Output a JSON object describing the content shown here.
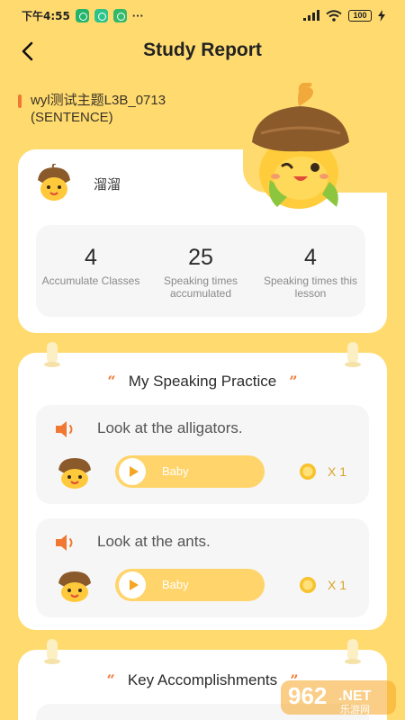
{
  "status": {
    "time": "下午4:55",
    "battery": "100",
    "dots": "···"
  },
  "header": {
    "title": "Study Report"
  },
  "topic": {
    "line1": "wyl测试主题L3B_0713",
    "line2": "(SENTENCE)"
  },
  "user": {
    "name": "溜溜"
  },
  "stats": [
    {
      "value": "4",
      "label": "Accumulate Classes"
    },
    {
      "value": "25",
      "label": "Speaking times accumulated"
    },
    {
      "value": "4",
      "label": "Speaking times this lesson"
    }
  ],
  "speaking": {
    "title": "My Speaking Practice",
    "open_quote": "“",
    "close_quote": "”",
    "items": [
      {
        "sentence": "Look at the alligators.",
        "speaker": "Baby",
        "count": "X 1"
      },
      {
        "sentence": "Look at the ants.",
        "speaker": "Baby",
        "count": "X 1"
      }
    ]
  },
  "accomplishments": {
    "title": "Key Accomplishments",
    "open_quote": "“",
    "close_quote": "”"
  },
  "watermark": {
    "brand": "962",
    "suffix": ".NET",
    "sub": "乐游网"
  },
  "colors": {
    "background": "#FFDB6F",
    "accent": "#F07833",
    "play_pill": "#FFD46A",
    "card": "#FFFFFF",
    "panel": "#F6F6F6"
  },
  "icons": {
    "back": "chevron-left-icon",
    "speaker": "speaker-icon",
    "play": "play-icon",
    "coin": "coin-icon"
  }
}
